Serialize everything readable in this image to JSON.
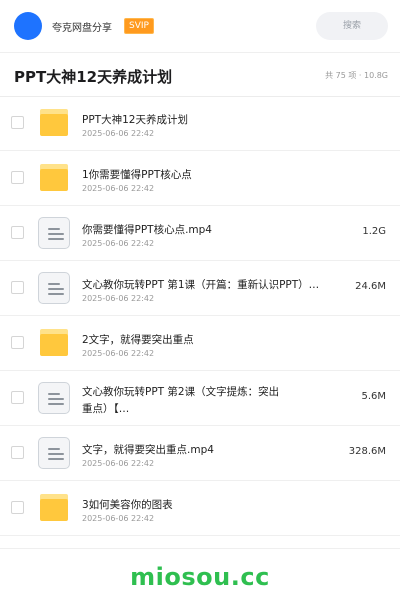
{
  "header": {
    "username": "夸克网盘分享",
    "badge": "SVIP",
    "search_placeholder": "搜索",
    "colors": {
      "avatar": "#1e73ff",
      "badge": "#ff9a1e"
    }
  },
  "folder": {
    "title": "PPT大神12天养成计划",
    "meta": "共 75 项 · 10.8G"
  },
  "files": [
    {
      "type": "folder",
      "name": "PPT大神12天养成计划",
      "date": "2025-06-06 22:42",
      "size": ""
    },
    {
      "type": "folder",
      "name": "1你需要懂得PPT核心点",
      "date": "2025-06-06 22:42",
      "size": ""
    },
    {
      "type": "file",
      "name": "你需要懂得PPT核心点.mp4",
      "date": "2025-06-06 22:42",
      "size": "1.2G"
    },
    {
      "type": "file",
      "name": "文心教你玩转PPT 第1课（开篇：重新认识PPT）…",
      "date": "2025-06-06 22:42",
      "size": "24.6M"
    },
    {
      "type": "folder",
      "name": "2文字，就得要突出重点",
      "date": "2025-06-06 22:42",
      "size": ""
    },
    {
      "type": "file",
      "name": "文心教你玩转PPT 第2课（文字提炼：突出重点）【…",
      "date": "2025-06-06 22:42",
      "size": "5.6M"
    },
    {
      "type": "file",
      "name": "文字，就得要突出重点.mp4",
      "date": "2025-06-06 22:42",
      "size": "328.6M"
    },
    {
      "type": "folder",
      "name": "3如何美容你的图表",
      "date": "2025-06-06 22:42",
      "size": ""
    }
  ],
  "footer": {
    "watermark": "miosou.cc"
  }
}
